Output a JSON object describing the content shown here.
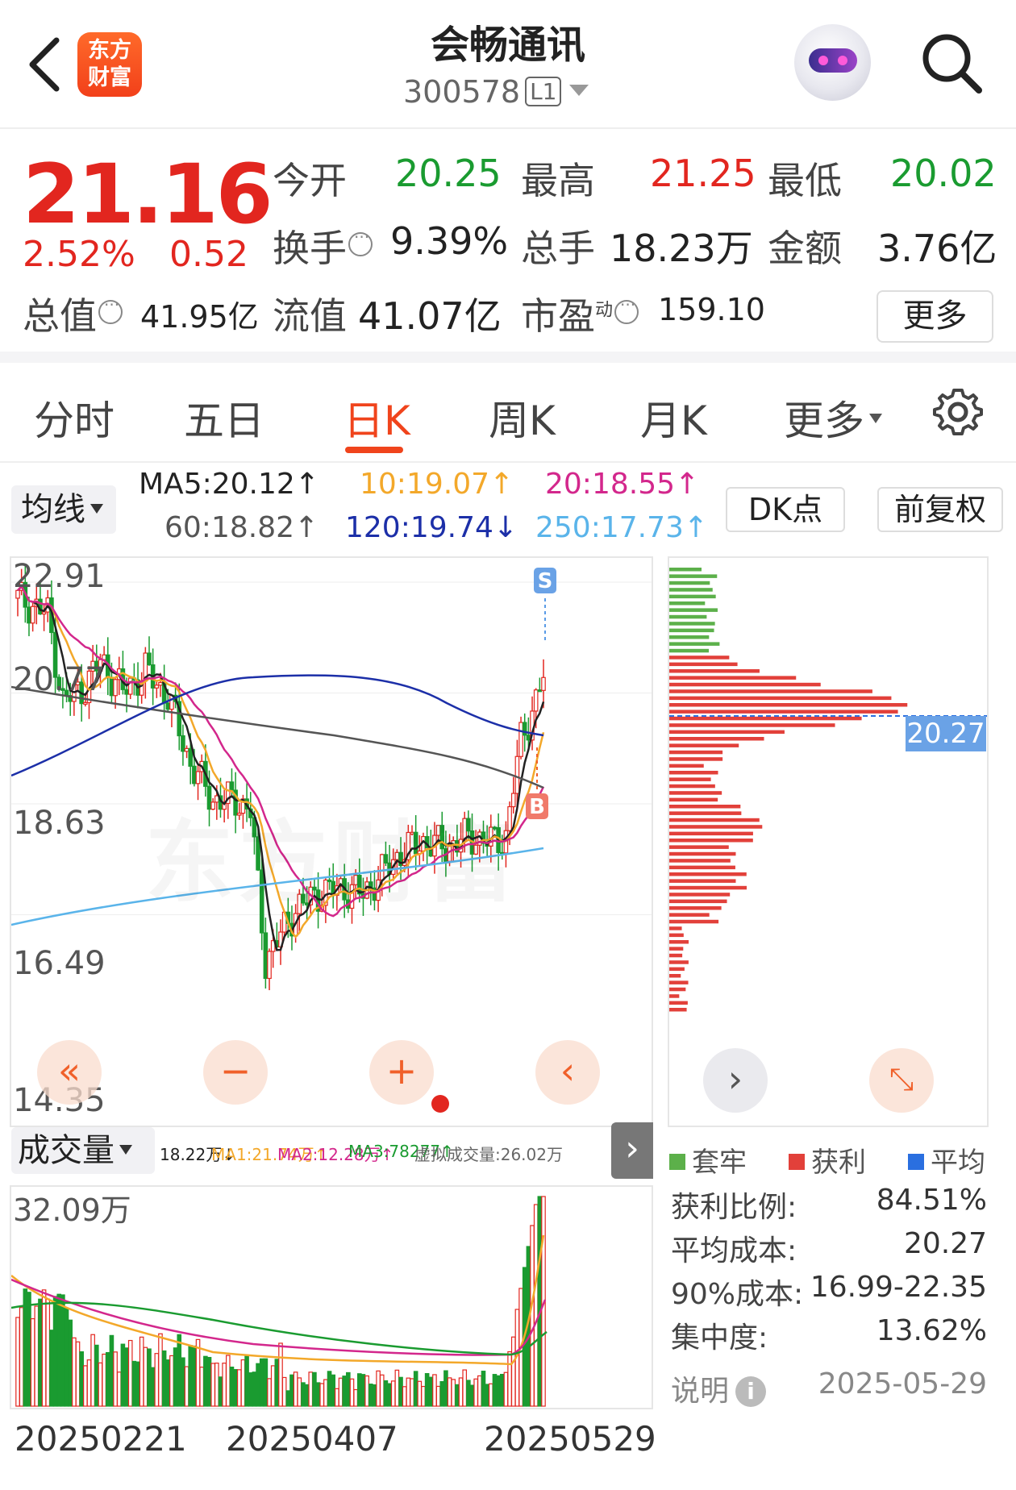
{
  "header": {
    "title": "会畅通讯",
    "code": "300578",
    "level": "L1",
    "logo_text_1": "东方",
    "logo_text_2": "财富"
  },
  "quote": {
    "price": "21.16",
    "change_pct": "2.52%",
    "change": "0.52",
    "open_label": "今开",
    "open": "20.25",
    "high_label": "最高",
    "high": "21.25",
    "low_label": "最低",
    "low": "20.02",
    "turnover_label": "换手",
    "turnover": "9.39%",
    "volume_label": "总手",
    "volume": "18.23万",
    "amount_label": "金额",
    "amount": "3.76亿",
    "mktcap_label": "总值",
    "mktcap": "41.95亿",
    "float_label": "流值",
    "float": "41.07亿",
    "pe_label": "市盈",
    "pe_sup": "动",
    "pe": "159.10",
    "more_label": "更多"
  },
  "tabs": [
    "分时",
    "五日",
    "日K",
    "周K",
    "月K",
    "更多"
  ],
  "active_tab": "日K",
  "ma": {
    "button": "均线",
    "ma5": "MA5:20.12↑",
    "ma10": "10:19.07↑",
    "ma20": "20:18.55↑",
    "ma60": "60:18.82↑",
    "ma120": "120:19.74↓",
    "ma250": "250:17.73↑",
    "dk_button": "DK点",
    "adjust_button": "前复权"
  },
  "colors": {
    "up": "#e2261f",
    "down": "#1a9b30",
    "ma5": "#222222",
    "ma10": "#f3a82a",
    "ma20": "#d3278c",
    "ma60": "#555555",
    "ma120": "#1c2fa8",
    "ma250": "#5ab4ea",
    "accent": "#f0441c"
  },
  "kchart": {
    "y_labels": [
      "22.91",
      "20.77",
      "18.63",
      "16.49",
      "14.35"
    ],
    "watermark": "东方财富",
    "sell_marker": "S",
    "buy_marker": "B"
  },
  "chips": {
    "avg_cost_tag": "20.27",
    "legend": [
      "套牢",
      "获利",
      "平均"
    ],
    "profit_ratio_label": "获利比例:",
    "profit_ratio": "84.51%",
    "avg_cost_label": "平均成本:",
    "avg_cost": "20.27",
    "cost90_label": "90%成本:",
    "cost90": "16.99-22.35",
    "concentration_label": "集中度:",
    "concentration": "13.62%",
    "note_label": "说明",
    "date": "2025-05-29"
  },
  "volume": {
    "button": "成交量",
    "vol": "18.22万↓",
    "ma1": "MA1:21.74万↑",
    "ma2": "MA2:12.28万↑",
    "ma3": "MA3:78277↑",
    "virtual": "虚拟成交量:26.02万",
    "top_label": "32.09万"
  },
  "dates": [
    "20250221",
    "20250407",
    "20250529"
  ],
  "icons": [
    "back-arrow-icon",
    "search-icon",
    "gear-icon",
    "info-icon",
    "chevron-right-icon",
    "expand-icon",
    "double-left-icon",
    "minus-icon",
    "plus-icon",
    "left-icon"
  ]
}
